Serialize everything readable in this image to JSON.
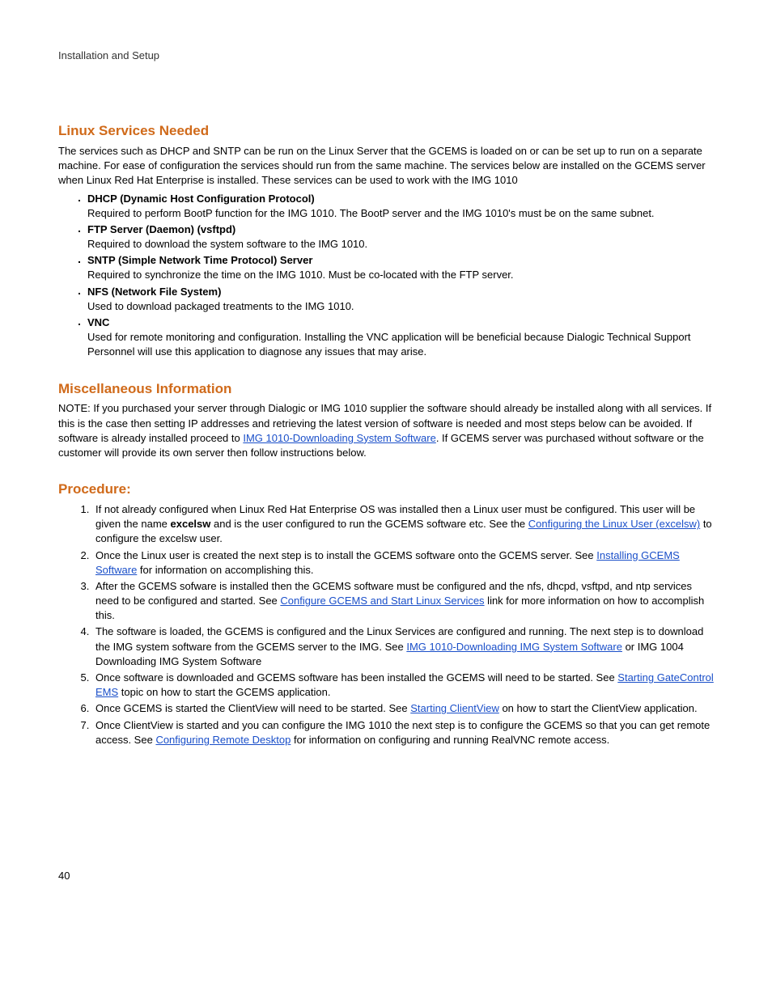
{
  "header": {
    "title": "Installation and Setup"
  },
  "pageNumber": "40",
  "sections": {
    "linux": {
      "heading": "Linux Services Needed",
      "intro": "The services such as DHCP and SNTP can be run on the Linux Server that the GCEMS is loaded on or can be set up to run on a separate machine. For ease of configuration the services should run from the same machine. The services below are installed on the GCEMS server when Linux Red Hat Enterprise is installed. These services can be used to work with the IMG 1010",
      "items": [
        {
          "title": "DHCP (Dynamic Host Configuration Protocol)",
          "desc": "Required to perform BootP function for the IMG 1010. The BootP server and the IMG 1010's must be on the same subnet."
        },
        {
          "title": "FTP Server (Daemon) (vsftpd)",
          "desc": "Required to download the system software to the IMG 1010."
        },
        {
          "title": "SNTP (Simple Network Time Protocol) Server",
          "desc": "Required to synchronize the time on the IMG 1010. Must be co-located with the FTP server."
        },
        {
          "title": "NFS (Network File System)",
          "desc": "Used to download packaged treatments to the IMG 1010."
        },
        {
          "title": "VNC",
          "desc": "Used for remote monitoring and configuration. Installing the VNC application will be beneficial because Dialogic Technical Support Personnel will use this application to diagnose any issues that may arise."
        }
      ]
    },
    "misc": {
      "heading": "Miscellaneous Information",
      "p1a": "NOTE: If you purchased your server through Dialogic or IMG 1010 supplier the software should already be installed along with all services. If this is the case then setting IP addresses and retrieving the latest version of software is needed and most steps below can be avoided. If software is already installed proceed to ",
      "link1": "IMG 1010-Downloading System Software",
      "p1b": ". If GCEMS server was purchased without software or the customer will provide its own server then follow instructions below."
    },
    "proc": {
      "heading": "Procedure:",
      "s1a": "If not already configured when Linux Red Hat Enterprise OS was installed then a Linux user must be configured. This user will be given the name ",
      "s1bold": "excelsw",
      "s1b": " and is the user configured to run the GCEMS software etc. See the ",
      "s1link": "Configuring the Linux User (excelsw)",
      "s1c": " to configure the excelsw user.",
      "s2a": "Once the Linux user is created the next step is to install the GCEMS software onto the GCEMS server. See ",
      "s2link": "Installing GCEMS Software",
      "s2b": " for information on accomplishing this.",
      "s3a": "After the GCEMS sofware is installed then the GCEMS software must be configured and the nfs, dhcpd, vsftpd, and ntp services need to be configured and started. See ",
      "s3link": "Configure GCEMS and Start Linux Services",
      "s3b": " link for more information on how to accomplish this.",
      "s4a": "The software is loaded, the GCEMS is configured and the Linux Services are configured and running. The next step is to download the IMG system software from the GCEMS server to the IMG. See ",
      "s4link": "IMG 1010-Downloading IMG System Software",
      "s4b": " or IMG 1004 Downloading IMG System Software",
      "s5a": "Once software is downloaded and GCEMS software has been installed the GCEMS will need to be started. See ",
      "s5link": "Starting GateControl EMS",
      "s5b": " topic on how to start the GCEMS application.",
      "s6a": "Once GCEMS is started the ClientView will need to be started. See ",
      "s6link": "Starting ClientView",
      "s6b": " on how to start the ClientView application.",
      "s7a": "Once ClientView is started and you can configure the IMG 1010 the next step is to configure the GCEMS so that you can get remote access. See ",
      "s7link": "Configuring Remote Desktop",
      "s7b": " for information on configuring and running RealVNC remote access."
    }
  }
}
